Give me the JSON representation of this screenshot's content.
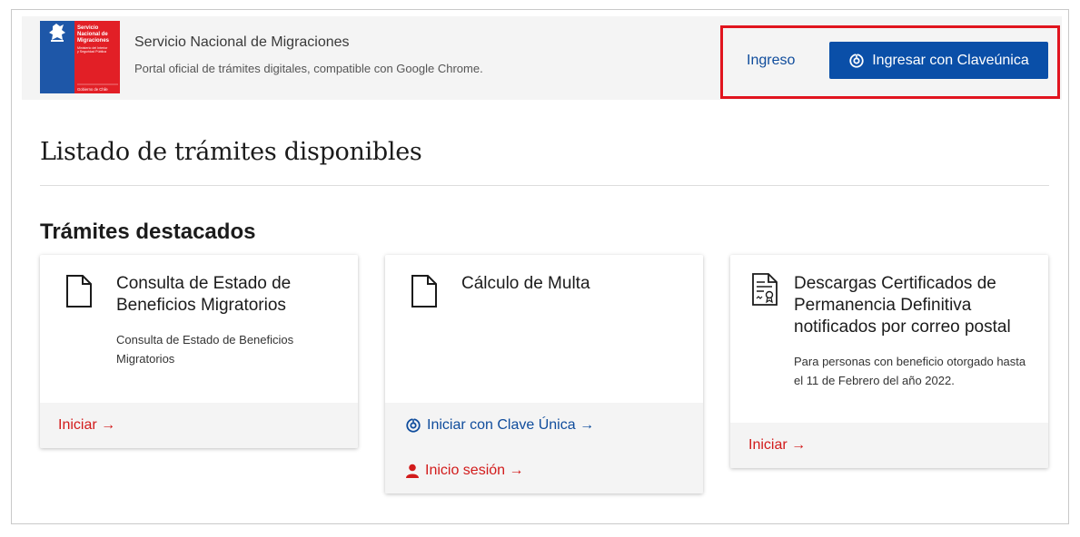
{
  "header": {
    "logo_text": [
      "Servicio",
      "Nacional de",
      "Migraciones",
      "Ministerio del Interior y Seguridad Pública",
      "Gobierno de Chile"
    ],
    "title": "Servicio Nacional de Migraciones",
    "subtitle": "Portal oficial de trámites digitales, compatible con Google Chrome.",
    "login_label": "Ingreso",
    "clave_button_label": "Ingresar con Claveúnica"
  },
  "page_title": "Listado de trámites disponibles",
  "section_title": "Trámites destacados",
  "cards": [
    {
      "icon": "document-icon",
      "title": "Consulta de Estado de Beneficios Migratorios",
      "description": "Consulta de Estado de Beneficios Migratorios",
      "action": "Iniciar →"
    },
    {
      "icon": "document-icon",
      "title": "Cálculo de Multa",
      "action_clave": "Iniciar con Clave Única →",
      "action_session": "Inicio sesión →"
    },
    {
      "icon": "certificate-icon",
      "title": "Descargas Certificados de Permanencia Definitiva notificados por correo postal",
      "description": "Para personas con beneficio otorgado hasta el 11 de Febrero del año 2022.",
      "action": "Iniciar →"
    }
  ],
  "colors": {
    "primary_blue": "#0a4fa8",
    "link_blue": "#0f4c9c",
    "link_red": "#d21b1b",
    "highlight_red": "#e1141e",
    "header_bg": "#f4f4f4"
  }
}
